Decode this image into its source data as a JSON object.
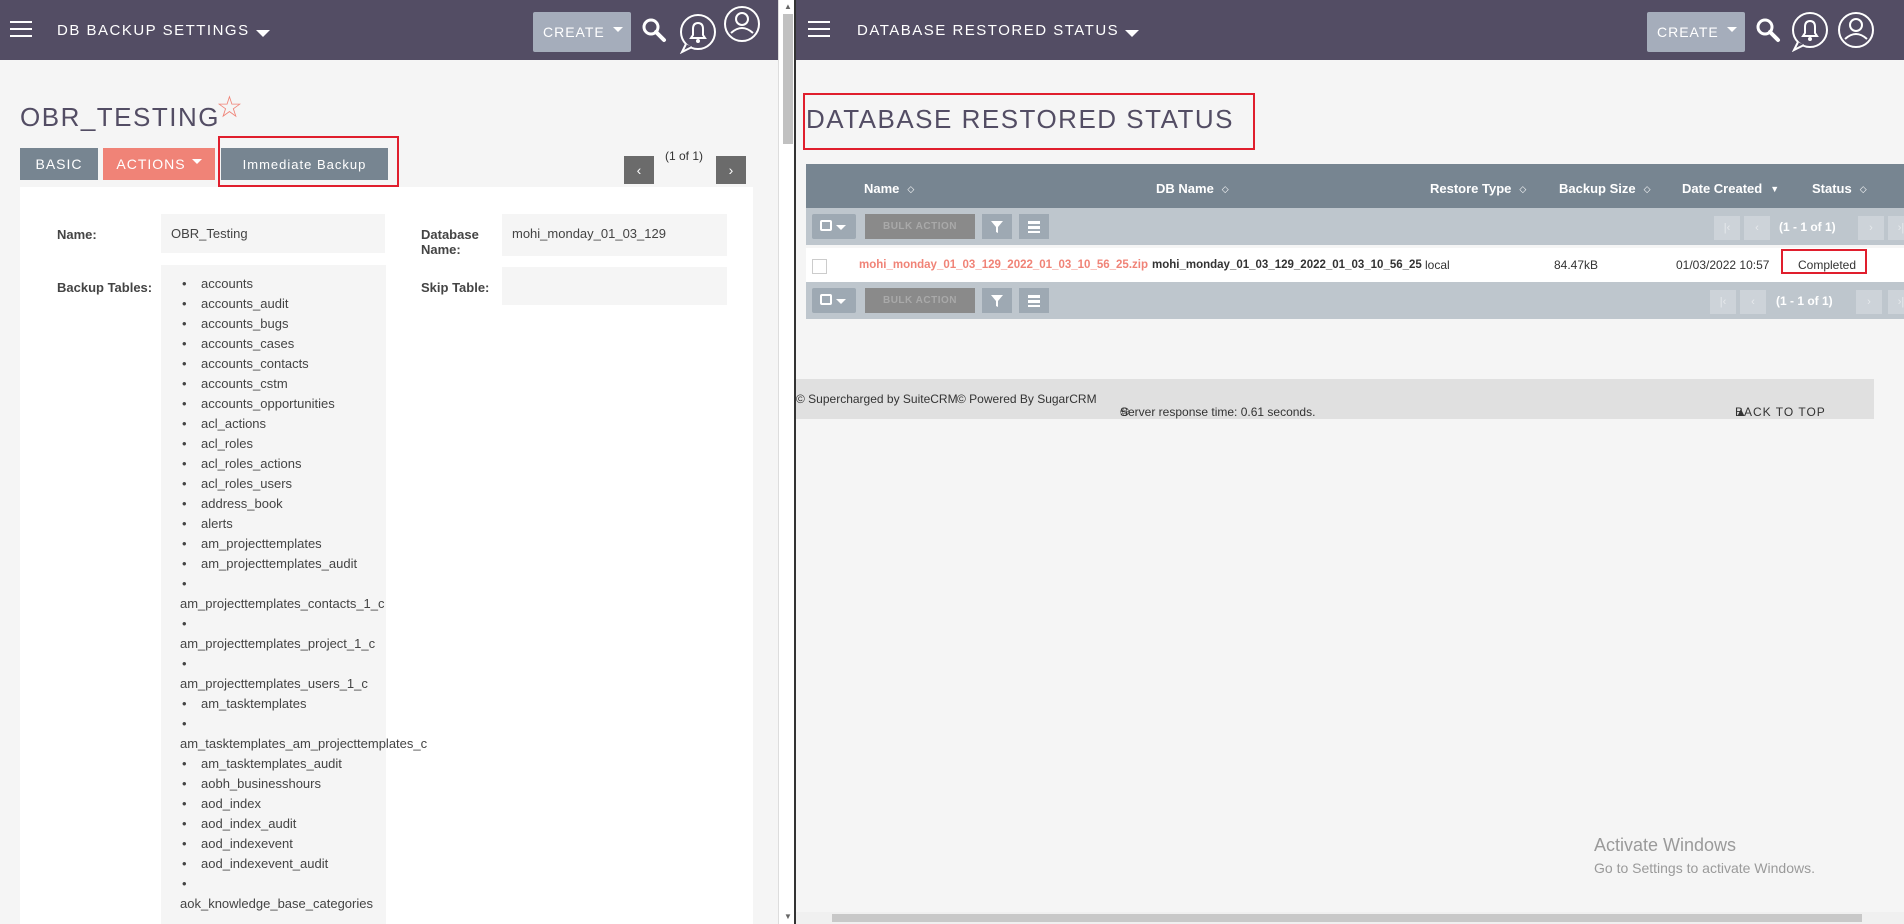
{
  "left": {
    "module_title": "DB BACKUP SETTINGS",
    "create_label": "CREATE",
    "record_title": "OBR_TESTING",
    "tabs": {
      "basic": "BASIC",
      "actions": "ACTIONS",
      "immediate": "Immediate Backup"
    },
    "pager": {
      "text": "(1 of 1)",
      "prev": "‹",
      "next": "›"
    },
    "fields": {
      "name_label": "Name:",
      "name_value": "OBR_Testing",
      "db_label_1": "Database",
      "db_label_2": "Name:",
      "db_value": "mohi_monday_01_03_129",
      "backup_tables_label": "Backup Tables:",
      "skip_table_label": "Skip Table:"
    },
    "tables": [
      "accounts",
      "accounts_audit",
      "accounts_bugs",
      "accounts_cases",
      "accounts_contacts",
      "accounts_cstm",
      "accounts_opportunities",
      "acl_actions",
      "acl_roles",
      "acl_roles_actions",
      "acl_roles_users",
      "address_book",
      "alerts",
      "am_projecttemplates",
      "am_projecttemplates_audit",
      "am_projecttemplates_contacts_1_c",
      "am_projecttemplates_project_1_c",
      "am_projecttemplates_users_1_c",
      "am_tasktemplates",
      "am_tasktemplates_am_projecttemplates_c",
      "am_tasktemplates_audit",
      "aobh_businesshours",
      "aod_index",
      "aod_index_audit",
      "aod_indexevent",
      "aod_indexevent_audit",
      "aok_knowledge_base_categories"
    ]
  },
  "right": {
    "module_title": "DATABASE RESTORED STATUS",
    "create_label": "CREATE",
    "page_title": "DATABASE RESTORED STATUS",
    "columns": {
      "name": "Name",
      "db_name": "DB Name",
      "restore_type": "Restore Type",
      "backup_size": "Backup Size",
      "date_created": "Date Created",
      "status": "Status"
    },
    "bulk_action": "BULK ACTION",
    "pagination": "(1 - 1 of 1)",
    "row": {
      "name": "mohi_monday_01_03_129_2022_01_03_10_56_25.zip",
      "db_name": "mohi_monday_01_03_129_2022_01_03_10_56_25",
      "restore_type": "local",
      "backup_size": "84.47kB",
      "date_created": "01/03/2022 10:57",
      "status": "Completed"
    },
    "footer": {
      "supercharged": "© Supercharged by SuiteCRM",
      "powered": "© Powered By SugarCRM",
      "response": "Server response time: 0.61 seconds.",
      "back_to_top": "BACK TO TOP"
    },
    "watermark": {
      "line1": "Activate Windows",
      "line2": "Go to Settings to activate Windows."
    }
  },
  "colors": {
    "topbar": "#534d64",
    "accent": "#f08377",
    "tab": "#778591",
    "highlight": "#e01e2d"
  }
}
